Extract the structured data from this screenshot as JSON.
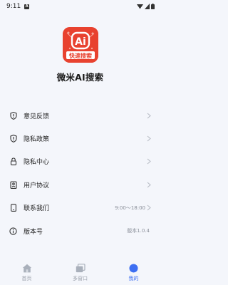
{
  "status_bar": {
    "time": "9:11",
    "notification_badge": "A"
  },
  "app": {
    "logo_text": "Ai",
    "logo_subtext": "快速搜索",
    "name": "微米AI搜索",
    "brand_color": "#e8422f"
  },
  "menu": [
    {
      "label": "意见反馈",
      "value": "",
      "icon": "shield-info-icon",
      "has_chevron": true
    },
    {
      "label": "隐私政策",
      "value": "",
      "icon": "shield-info-icon",
      "has_chevron": true
    },
    {
      "label": "隐私中心",
      "value": "",
      "icon": "lock-icon",
      "has_chevron": true
    },
    {
      "label": "用户协议",
      "value": "",
      "icon": "id-card-icon",
      "has_chevron": true
    },
    {
      "label": "联系我们",
      "value": "9:00～18:00",
      "icon": "phone-icon",
      "has_chevron": true
    },
    {
      "label": "版本号",
      "value": "版本1.0.4",
      "icon": "info-circle-icon",
      "has_chevron": false
    }
  ],
  "tabs": [
    {
      "label": "首页",
      "icon": "home-icon",
      "active": false
    },
    {
      "label": "多窗口",
      "icon": "windows-icon",
      "active": false
    },
    {
      "label": "我的",
      "icon": "profile-dot-icon",
      "active": true
    }
  ],
  "colors": {
    "accent": "#3d6ff2",
    "inactive": "#9aa0aa",
    "background": "#f4f6fb"
  }
}
